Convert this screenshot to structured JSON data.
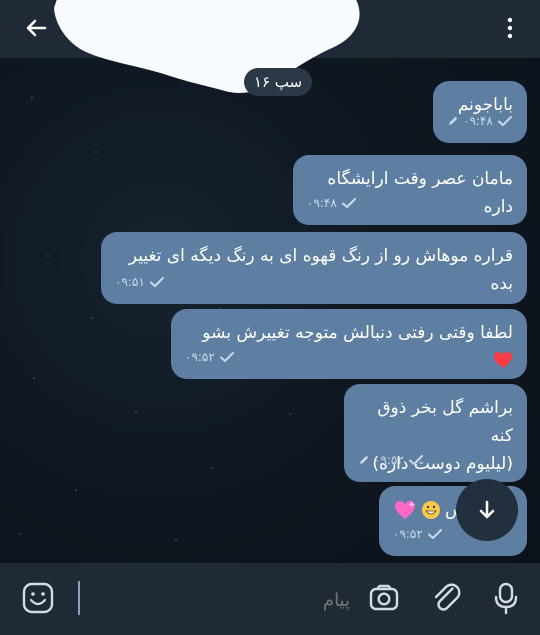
{
  "date_chip": "۱۶ سپ",
  "messages": [
    {
      "text": "باباجونم",
      "time": "۰۹:۴۸",
      "edited": true
    },
    {
      "text": "مامان عصر وقت ارایشگاه داره",
      "time": "۰۹:۴۸",
      "edited": false
    },
    {
      "text": "قراره موهاش رو از رنگ قهوه ای به رنگ دیگه ای تغییر بده",
      "time": "۰۹:۵۱",
      "edited": false
    },
    {
      "text": "لطفا وقتی رفتی دنبالش متوجه تغییرش بشو",
      "time": "۰۹:۵۲",
      "edited": false
    },
    {
      "text": "براشم گل بخر ذوق کنه\n(لیلیوم دوست داره)",
      "time": "۰۹:۵۲",
      "edited": true
    },
    {
      "text": "س",
      "time": "۰۹:۵۲",
      "edited": false
    }
  ],
  "input": {
    "placeholder": "پیام"
  },
  "icons": {
    "back": "arrow-left-icon",
    "menu": "more-vertical-icon",
    "scroll": "arrow-down-icon",
    "emoji": "emoji-icon",
    "camera": "camera-icon",
    "attach": "paperclip-icon",
    "mic": "microphone-icon"
  }
}
